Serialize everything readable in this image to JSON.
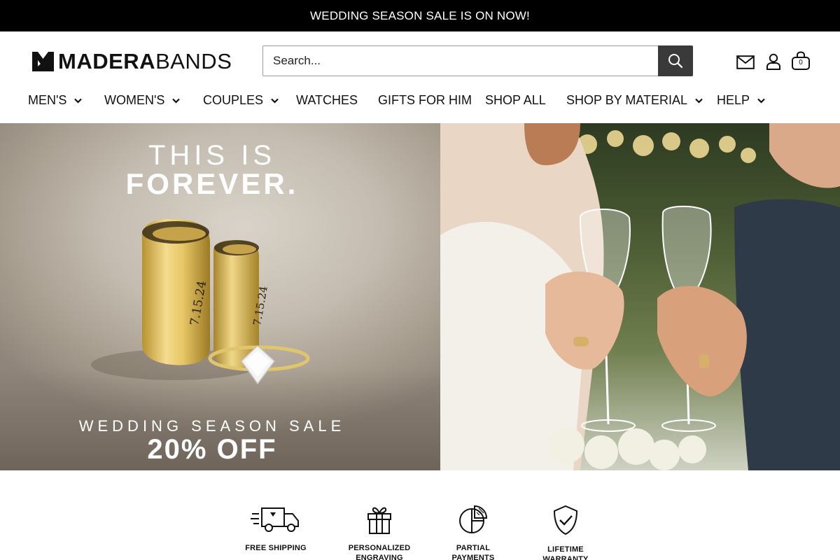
{
  "announcement": "WEDDING SEASON SALE IS ON NOW!",
  "brand": {
    "name_bold": "MADERA",
    "name_light": "BANDS"
  },
  "search": {
    "placeholder": "Search..."
  },
  "cart": {
    "count": "0"
  },
  "nav": [
    {
      "label": "MEN'S",
      "has_dropdown": true
    },
    {
      "label": "WOMEN'S",
      "has_dropdown": true
    },
    {
      "label": "COUPLES",
      "has_dropdown": true
    },
    {
      "label": "WATCHES",
      "has_dropdown": false
    },
    {
      "label": "GIFTS FOR HIM",
      "has_dropdown": false
    },
    {
      "label": "SHOP ALL",
      "has_dropdown": false
    },
    {
      "label": "SHOP BY MATERIAL",
      "has_dropdown": true
    },
    {
      "label": "HELP",
      "has_dropdown": true
    }
  ],
  "hero": {
    "line1": "THIS IS",
    "line2": "FOREVER.",
    "sale": "WEDDING SEASON SALE",
    "offer": "20% OFF",
    "engraving": "7.15.24"
  },
  "features": [
    {
      "label": "FREE SHIPPING",
      "icon": "truck-icon"
    },
    {
      "label": "PERSONALIZED ENGRAVING",
      "icon": "gift-icon"
    },
    {
      "label": "PARTIAL PAYMENTS",
      "icon": "pie-chart-icon"
    },
    {
      "label": "LIFETIME WARRANTY",
      "icon": "shield-check-icon"
    }
  ],
  "colors": {
    "topbar": "#000000",
    "search_button": "#3a3a3a",
    "text": "#111111"
  }
}
